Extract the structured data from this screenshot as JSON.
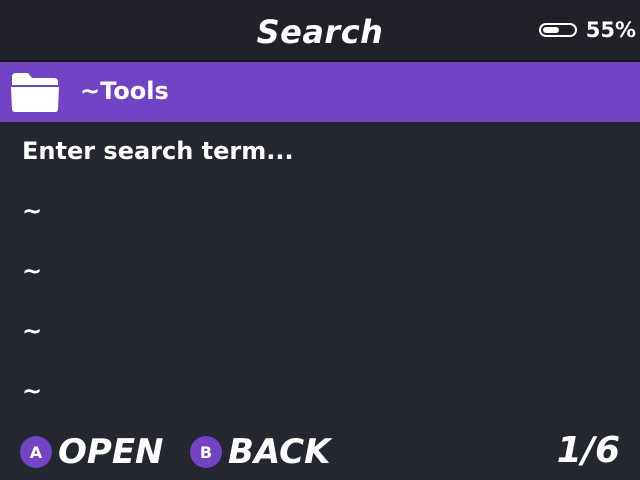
{
  "header": {
    "title": "Search",
    "battery_percent_label": "55%",
    "battery_level": 0.55
  },
  "list": {
    "selected": {
      "icon": "folder-icon",
      "label": "~Tools"
    },
    "items": [
      "Enter search term...",
      "~",
      "~",
      "~",
      "~"
    ]
  },
  "footer": {
    "open_key": "A",
    "open_label": "OPEN",
    "back_key": "B",
    "back_label": "BACK",
    "page_counter": "1/6"
  },
  "colors": {
    "accent": "#7044c4",
    "background": "#242630",
    "header_background": "#1f2028",
    "text": "#ffffff"
  }
}
